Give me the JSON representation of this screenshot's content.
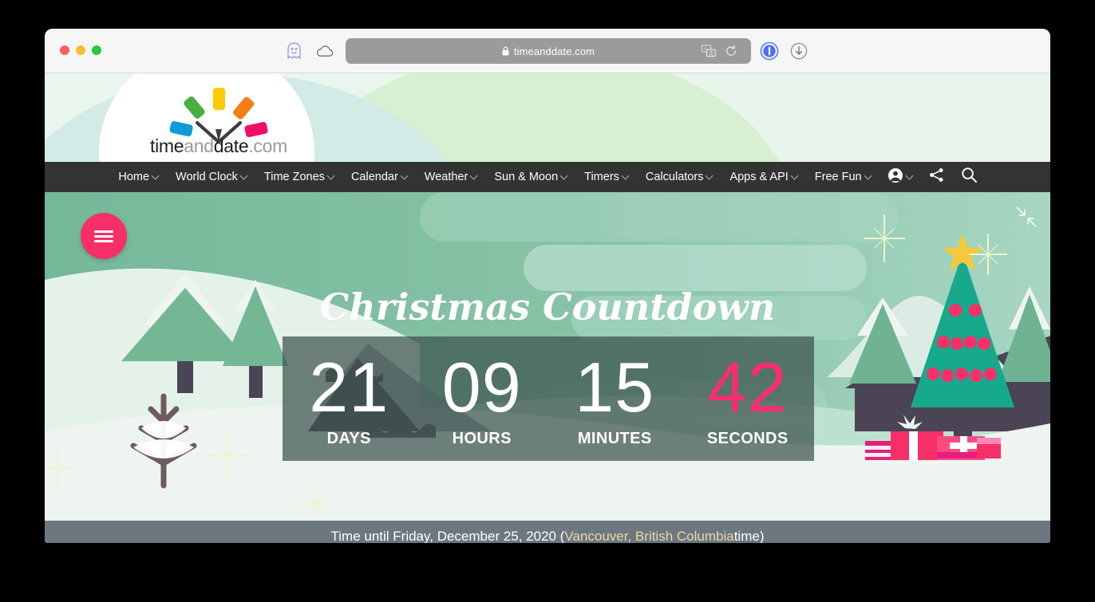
{
  "browser": {
    "address_bar": {
      "url": "timeanddate.com",
      "lock_icon": "lock-icon",
      "translate_icon": "translate-icon",
      "reload_icon": "reload-icon"
    },
    "toolbar_icons": [
      {
        "name": "ghostery-icon",
        "label": "Ghostery"
      },
      {
        "name": "icloud-icon",
        "label": "iCloud"
      },
      {
        "name": "onepassword-icon",
        "label": "1Password"
      },
      {
        "name": "downloads-icon",
        "label": "Downloads"
      }
    ],
    "window_controls": [
      "close",
      "minimize",
      "zoom"
    ]
  },
  "site": {
    "logo": {
      "word_time": "time",
      "word_and": "and",
      "word_date": "date",
      "word_com": ".com"
    }
  },
  "nav": {
    "items": [
      {
        "label": "Home",
        "caret": true
      },
      {
        "label": "World Clock",
        "caret": true
      },
      {
        "label": "Time Zones",
        "caret": true
      },
      {
        "label": "Calendar",
        "caret": true
      },
      {
        "label": "Weather",
        "caret": true
      },
      {
        "label": "Sun & Moon",
        "caret": true
      },
      {
        "label": "Timers",
        "caret": true
      },
      {
        "label": "Calculators",
        "caret": true
      },
      {
        "label": "Apps & API",
        "caret": true
      },
      {
        "label": "Free Fun",
        "caret": true
      }
    ],
    "account_icon": "account-icon",
    "share_icon": "share-icon",
    "search_icon": "search-icon"
  },
  "hero": {
    "menu_button": "hamburger-menu-icon",
    "fullscreen_button": "exit-fullscreen-icon",
    "title": "Christmas Countdown",
    "countdown": [
      {
        "value": "21",
        "label": "DAYS",
        "accent": false
      },
      {
        "value": "09",
        "label": "HOURS",
        "accent": false
      },
      {
        "value": "15",
        "label": "MINUTES",
        "accent": false
      },
      {
        "value": "42",
        "label": "SECONDS",
        "accent": true
      }
    ]
  },
  "footer": {
    "prefix": "Time until Friday, December 25, 2020 (",
    "location": "Vancouver, British Columbia",
    "suffix": " time)"
  },
  "colors": {
    "accent_pink": "#f72f69",
    "seconds_pink": "#f92d6d",
    "nav_bar": "#333333",
    "sky_green": "#7cbd9e",
    "snow": "#eef5f0",
    "mountain_dark": "#4a4455",
    "tree_green": "#6fb392",
    "tree_teal": "#17a98c",
    "footer_bar": "#6d7780",
    "footer_link": "#ead9a0",
    "star_yellow": "#f7c83c",
    "countdown_overlay": "rgba(60,82,76,.72)"
  }
}
